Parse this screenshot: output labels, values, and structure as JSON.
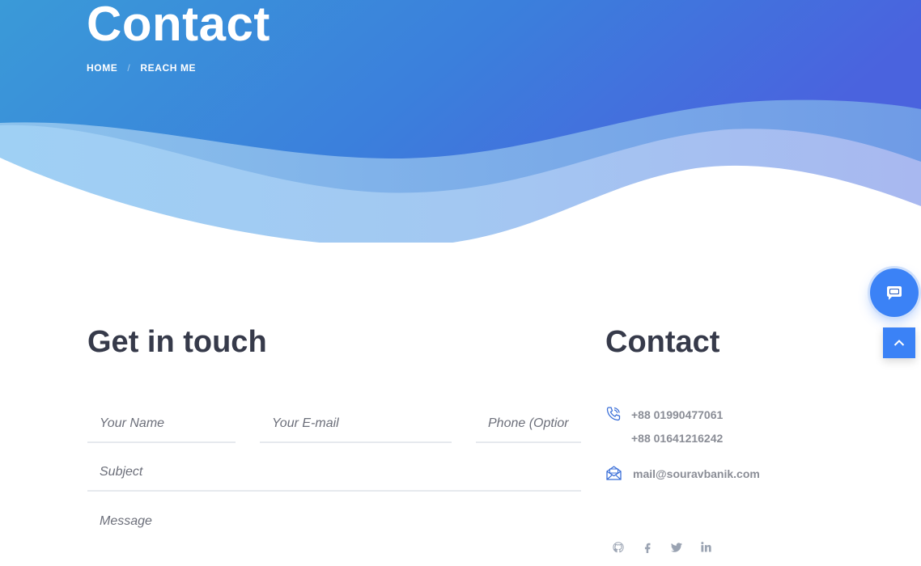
{
  "hero": {
    "title": "Contact",
    "breadcrumb": {
      "home": "HOME",
      "separator": "/",
      "current": "REACH ME"
    }
  },
  "form": {
    "heading": "Get in touch",
    "name_placeholder": "Your Name",
    "email_placeholder": "Your E-mail",
    "phone_placeholder": "Phone (Optional)",
    "subject_placeholder": "Subject",
    "message_placeholder": "Message"
  },
  "contact": {
    "heading": "Contact",
    "phone_1": "+88 01990477061",
    "phone_2": "+88 01641216242",
    "email": "mail@souravbanik.com",
    "icons": {
      "phone": "phone-ringing-icon",
      "email": "open-envelope-icon"
    }
  },
  "social": [
    {
      "icon": "github-icon"
    },
    {
      "icon": "facebook-icon"
    },
    {
      "icon": "twitter-icon"
    },
    {
      "icon": "linkedin-icon"
    }
  ],
  "floating": {
    "chat_icon": "chat-bubble-icon",
    "top_icon": "chevron-up-icon"
  },
  "colors": {
    "accent": "#3b82f6",
    "heading": "#363a4a",
    "muted_text": "#8a8d96"
  }
}
